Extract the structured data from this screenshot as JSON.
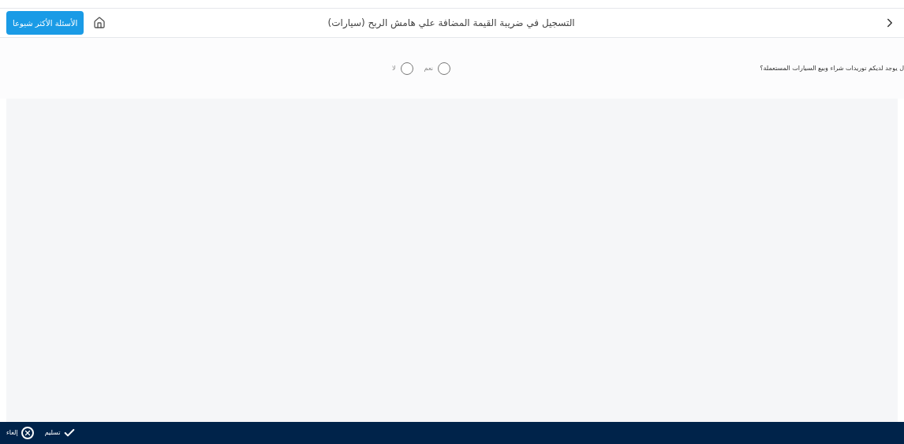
{
  "header": {
    "title": "التسجيل في ضريبة القيمة المضافة علي هامش الربح (سيارات)",
    "faq_button": "الأسئلة الأكثر شيوعا"
  },
  "question": {
    "text": "ل يوجد لديكم توريدات شراء وبيع السيارات المستعملة؟",
    "options": [
      {
        "label": "نعم",
        "selected": false
      },
      {
        "label": "لا",
        "selected": false
      }
    ]
  },
  "footer": {
    "buttons": [
      {
        "kind": "submit",
        "label": "تسليم"
      },
      {
        "kind": "cancel",
        "label": "إلغاء"
      }
    ]
  }
}
